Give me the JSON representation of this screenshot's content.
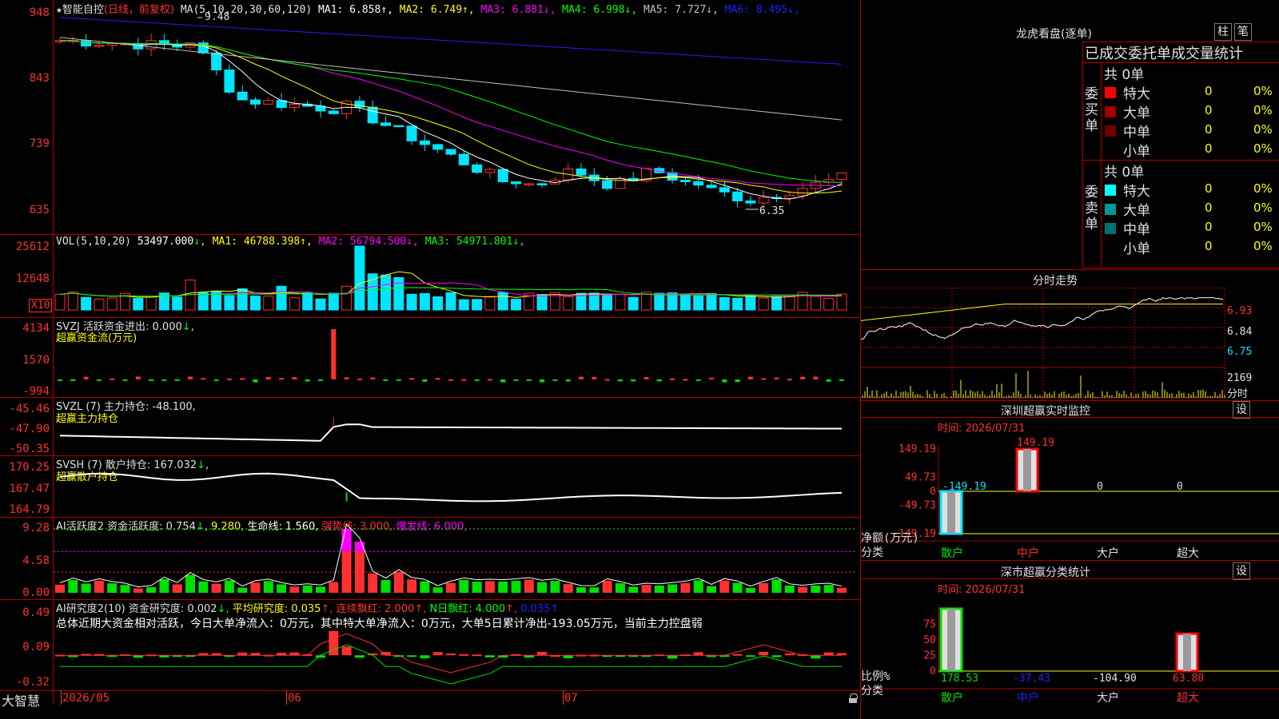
{
  "app": {
    "brand": "大智慧"
  },
  "price_panel": {
    "star": "★",
    "stock_name": "智能自控",
    "period": "(日线，前复权)",
    "ma_label": "MA(5,10,20,30,60,120)",
    "ma_values": [
      {
        "label": "MA1: 6.858",
        "arrow": "↑",
        "color": "#ffffff"
      },
      {
        "label": "MA2: 6.749",
        "arrow": "↑",
        "color": "#ffff00"
      },
      {
        "label": "MA3: 6.881",
        "arrow": "↓",
        "color": "#ff00ff"
      },
      {
        "label": "MA4: 6.998",
        "arrow": "↓",
        "color": "#00ff00"
      },
      {
        "label": "MA5: 7.727",
        "arrow": "↓",
        "color": "#c0c0c0"
      },
      {
        "label": "MA6: 8.495",
        "arrow": "↓",
        "color": "#2020ff"
      }
    ],
    "y_ticks": [
      "948",
      "843",
      "739",
      "635"
    ],
    "high_label": "9.48",
    "low_label": "6.35"
  },
  "vol_panel": {
    "title": "VOL(5,10,20)",
    "value": "53497.000",
    "value_arrow": "↓",
    "ma": [
      {
        "label": "MA1: 46788.398",
        "arrow": "↑",
        "color": "#ffff00"
      },
      {
        "label": "MA2: 56794.500",
        "arrow": "↓",
        "color": "#ff00ff"
      },
      {
        "label": "MA3: 54971.801",
        "arrow": "↓",
        "color": "#00ff00"
      }
    ],
    "y_ticks": [
      "25612",
      "12648"
    ],
    "unit": "X10"
  },
  "svzj_panel": {
    "title": "SVZJ  活跃资金进出: 0.000",
    "arrow": "↓",
    "subtitle": "超赢资金流(万元)",
    "y_ticks": [
      "4134",
      "1570",
      "-994"
    ]
  },
  "svzl_panel": {
    "title": "SVZL (7) 主力持仓: -48.100,",
    "subtitle": "超赢主力持仓",
    "y_ticks": [
      "-45.46",
      "-47.90",
      "-50.35"
    ]
  },
  "svsh_panel": {
    "title": "SVSH (7) 散户持仓: 167.032",
    "arrow": "↓",
    "subtitle": "超赢散户持仓",
    "y_ticks": [
      "170.25",
      "167.47",
      "164.79"
    ]
  },
  "ai_active_panel": {
    "title": "AI活跃度2 资金活跃度: 0.754",
    "items": [
      {
        "text": "↓",
        "color": "#00ff00"
      },
      {
        "text": ", 9.280,",
        "color": "#ffff00"
      },
      {
        "text": " 生命线: 1.560,",
        "color": "#ffffff"
      },
      {
        "text": " 强势线: 3.000,",
        "color": "#ff3030"
      },
      {
        "text": " 爆发线: 6.000,",
        "color": "#ff00ff"
      }
    ],
    "y_ticks": [
      "9.28",
      "4.58",
      "0.00"
    ]
  },
  "ai_research_panel": {
    "title": "AI研究度2(10) 资金研究度: 0.002",
    "items": [
      {
        "text": "↓,",
        "color": "#00ff00"
      },
      {
        "text": " 平均研究度: 0.035",
        "color": "#ffff00"
      },
      {
        "text": "↑,",
        "color": "#ff3030"
      },
      {
        "text": " 连续飘红: 2.000",
        "color": "#ff3030"
      },
      {
        "text": "↑,",
        "color": "#ff3030"
      },
      {
        "text": " N日飘红: 4.000",
        "color": "#00ff00"
      },
      {
        "text": "↑,",
        "color": "#ff3030"
      },
      {
        "text": " 0.035",
        "color": "#2020ff"
      },
      {
        "text": "↑",
        "color": "#2020ff"
      }
    ],
    "summary": "总体近期大资金相对活跃，今日大单净流入：0万元，其中特大单净流入：0万元，大单5日累计净出-193.05万元，当前主力控盘弱",
    "y_ticks": [
      "0.49",
      "0.09",
      "-0.32"
    ]
  },
  "x_axis": {
    "labels": [
      "2026/05",
      "06",
      "07"
    ]
  },
  "dragon_tiger": {
    "title": "龙虎看盘(逐单)",
    "btn_zhu": "柱",
    "btn_bi": "笔",
    "header": "已成交委托单成交量统计",
    "buy": {
      "side_label": "委买单",
      "total": "共 0单",
      "rows": [
        {
          "name": "特大",
          "vol": "0",
          "pct": "0%",
          "color": "#ff0000"
        },
        {
          "name": "大单",
          "vol": "0",
          "pct": "0%",
          "color": "#a00000"
        },
        {
          "name": "中单",
          "vol": "0",
          "pct": "0%",
          "color": "#700000"
        },
        {
          "name": "小单",
          "vol": "0",
          "pct": "0%",
          "color": "#000000"
        }
      ]
    },
    "sell": {
      "side_label": "委卖单",
      "total": "共 0单",
      "rows": [
        {
          "name": "特大",
          "vol": "0",
          "pct": "0%",
          "color": "#00ffff"
        },
        {
          "name": "大单",
          "vol": "0",
          "pct": "0%",
          "color": "#009999"
        },
        {
          "name": "中单",
          "vol": "0",
          "pct": "0%",
          "color": "#007070"
        },
        {
          "name": "小单",
          "vol": "0",
          "pct": "0%",
          "color": "#000000"
        }
      ]
    }
  },
  "intraday": {
    "title": "分时走势",
    "y_ticks": [
      "6.93",
      "6.84",
      "6.75"
    ],
    "vol_tick": "2169",
    "unit": "分时"
  },
  "sz_monitor": {
    "title": "深圳超赢实时监控",
    "btn": "设",
    "time_label": "时间: 2026/07/31",
    "y_ticks": [
      "149.19",
      "49.73",
      "0",
      "-49.73",
      "-149.19"
    ],
    "axis_title": "净额(万元)",
    "cat_label": "分类",
    "categories": [
      "散户",
      "中户",
      "大户",
      "超大"
    ],
    "values": [
      -149.19,
      149.19,
      0,
      0
    ],
    "value_labels": [
      "-149.19",
      "149.19",
      "0",
      "0"
    ]
  },
  "sz_category": {
    "title": "深市超赢分类统计",
    "btn": "设",
    "time_label": "时间: 2026/07/31",
    "y_ticks": [
      "75",
      "50",
      "25",
      "0"
    ],
    "axis_title": "比例%",
    "cat_label": "分类",
    "categories": [
      "散户",
      "中户",
      "大户",
      "超大"
    ],
    "value_labels": [
      "178.53",
      "-37.43",
      "-104.90",
      "63.80"
    ],
    "bars": [
      100,
      0,
      0,
      60
    ]
  },
  "colors": {
    "up": "#ff3030",
    "down": "#00e5ff",
    "frame": "#b00000"
  }
}
